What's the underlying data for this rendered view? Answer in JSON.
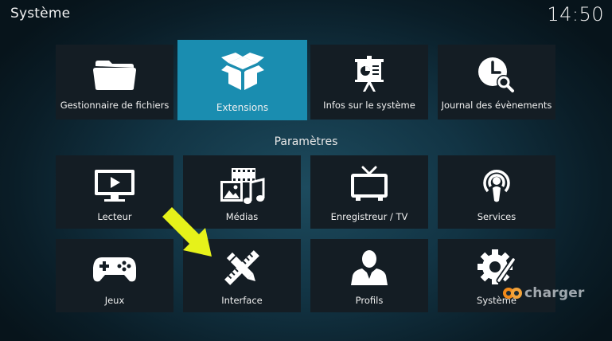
{
  "header": {
    "title": "Système",
    "clock": "14:50"
  },
  "top_row": [
    {
      "label": "Gestionnaire de fichiers",
      "icon": "folder-icon"
    },
    {
      "label": "Extensions",
      "icon": "box-icon",
      "focused": true
    },
    {
      "label": "Infos sur le système",
      "icon": "presentation-board-icon"
    },
    {
      "label": "Journal des évènements",
      "icon": "clock-search-icon"
    }
  ],
  "section": {
    "label": "Paramètres"
  },
  "settings_row_1": [
    {
      "label": "Lecteur",
      "icon": "monitor-play-icon"
    },
    {
      "label": "Médias",
      "icon": "media-film-music-icon"
    },
    {
      "label": "Enregistreur / TV",
      "icon": "tv-antenna-icon"
    },
    {
      "label": "Services",
      "icon": "broadcast-podcast-icon"
    }
  ],
  "settings_row_2": [
    {
      "label": "Jeux",
      "icon": "gamepad-icon"
    },
    {
      "label": "Interface",
      "icon": "pencil-ruler-icon"
    },
    {
      "label": "Profils",
      "icon": "user-profile-icon"
    },
    {
      "label": "Système",
      "icon": "gear-tools-icon"
    }
  ],
  "annotation": {
    "arrow_color": "#e6f21a",
    "pointing_to": "Interface"
  },
  "watermark": {
    "text": "charger"
  },
  "colors": {
    "focus": "#1a8db0",
    "tile": "#141d24",
    "text": "#f0f0f0"
  }
}
